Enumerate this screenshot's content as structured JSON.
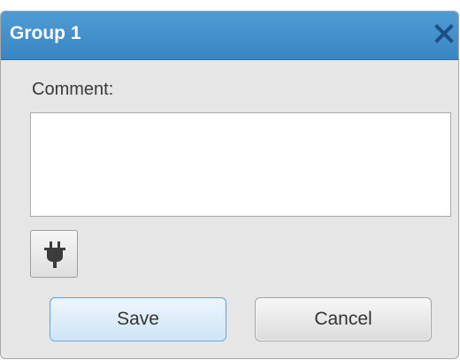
{
  "dialog": {
    "title": "Group 1",
    "close_icon": "close-icon",
    "comment_label": "Comment:",
    "comment_value": "",
    "plug_icon": "plug-icon",
    "save_label": "Save",
    "cancel_label": "Cancel"
  },
  "colors": {
    "titlebar": "#3a86c4",
    "dialog_bg": "#e6e6e6",
    "save_border": "#62a6dc"
  }
}
